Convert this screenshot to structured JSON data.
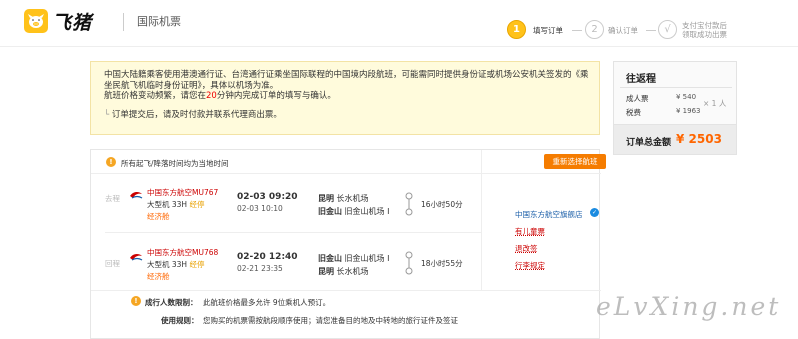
{
  "header": {
    "logo_text": "飞猪",
    "title": "国际机票"
  },
  "steps": [
    {
      "num": "1",
      "label": "填写订单",
      "active": true
    },
    {
      "num": "2",
      "label": "确认订单",
      "active": false
    },
    {
      "num": "√",
      "label": "支付宝付款后\n领取成功出票",
      "active": false
    }
  ],
  "notice": {
    "text_1": "中国大陆籍乘客使用港澳通行证、台湾通行证乘坐国际联程的中国境内段航班，可能需同时提供身份证或机场公安机关签发的《乘坐民航飞机临时身份证明》，具体以机场为准。",
    "text_2a": "航班价格变动频繁，请您在",
    "text_2_red": "20",
    "text_2b": "分钟内完成订单的填写与确认。",
    "sub": "订单提交后，请及时付款并联系代理商出票。"
  },
  "summary": {
    "title": "往返程",
    "rows": [
      {
        "label": "成人票",
        "value": "¥ 540"
      },
      {
        "label": "税费",
        "value": "¥ 1963"
      }
    ],
    "quantity": "× 1 人",
    "total_label": "订单总金额",
    "total_price": "¥ 2503"
  },
  "flight": {
    "header_text": "所有起飞/降落时间均为当地时间",
    "reselect_label": "重新选择航班",
    "legs": [
      {
        "tag": "去程",
        "airline": "中国东方航空MU767",
        "aircraft": "大型机 33H",
        "stop": "经停",
        "cabin": "经济舱",
        "dep_time": "02-03 09:20",
        "arr_time": "02-03 10:10",
        "dep_city": "昆明",
        "dep_airport": "长水机场",
        "arr_city": "旧金山",
        "arr_airport": "旧金山机场 I",
        "duration": "16小时50分"
      },
      {
        "tag": "回程",
        "airline": "中国东方航空MU768",
        "aircraft": "大型机 33H",
        "stop": "经停",
        "cabin": "经济舱",
        "dep_time": "02-20 12:40",
        "arr_time": "02-21 23:35",
        "dep_city": "旧金山",
        "dep_airport": "旧金山机场 I",
        "arr_city": "昆明",
        "arr_airport": "长水机场",
        "duration": "18小时55分"
      }
    ],
    "store_name": "中国东方航空旗舰店",
    "links": [
      "有儿童票",
      "退改签",
      "行李规定"
    ],
    "restriction_label": "成行人数限制：",
    "restriction_text": "此航班价格最多允许 9位乘机人预订。",
    "usage_label": "使用规则：",
    "usage_text": "您购买的机票需按航段顺序使用；请您准备目的地及中转地的旅行证件及签证"
  },
  "watermark": "eLvXing.net",
  "colors": {
    "brand": "#ffc21a",
    "price": "#ff6600",
    "accent": "#f57c00"
  }
}
